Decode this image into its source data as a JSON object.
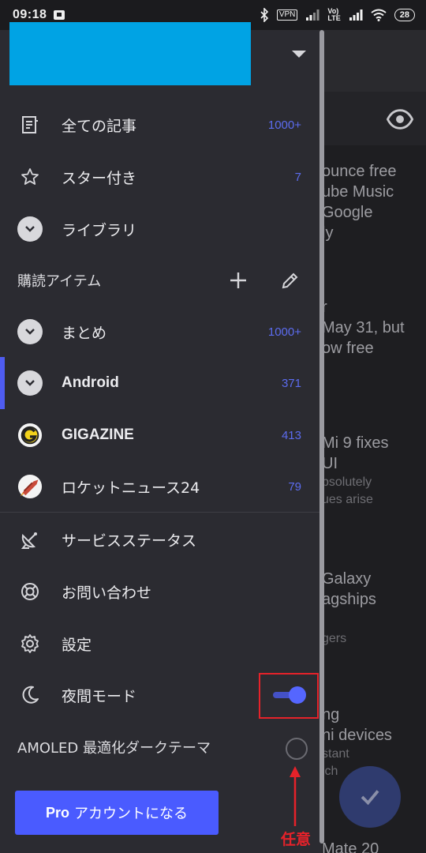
{
  "status_bar": {
    "time": "09:18",
    "vpn": "VPN",
    "network": "Vo)\nLTE",
    "battery": "28"
  },
  "drawer": {
    "items_top": [
      {
        "label": "全ての記事",
        "count": "1000+",
        "icon": "articles-icon"
      },
      {
        "label": "スター付き",
        "count": "7",
        "icon": "star-icon"
      },
      {
        "label": "ライブラリ",
        "count": "",
        "icon": "chevron-down-icon"
      }
    ],
    "subscriptions_label": "購読アイテム",
    "feeds": [
      {
        "label": "まとめ",
        "count": "1000+",
        "icon": "chevron-down-icon"
      },
      {
        "label": "Android",
        "count": "371",
        "icon": "chevron-down-icon"
      },
      {
        "label": "GIGAZINE",
        "count": "413",
        "icon": "gigazine-logo"
      },
      {
        "label": "ロケットニュース24",
        "count": "79",
        "icon": "rocket-icon"
      }
    ],
    "items_bottom": [
      {
        "label": "サービスステータス",
        "icon": "satellite-dish-icon"
      },
      {
        "label": "お問い合わせ",
        "icon": "lifebuoy-icon"
      },
      {
        "label": "設定",
        "icon": "gear-icon"
      },
      {
        "label": "夜間モード",
        "icon": "moon-icon"
      }
    ],
    "night_mode_on": true,
    "amoled_label": "AMOLED 最適化ダークテーマ",
    "pro_button_prefix": "Pro",
    "pro_button_label": "アカウントになる",
    "annotation": "任意"
  },
  "background": {
    "snippets": [
      "ounce free\nube Music\nGoogle\nly",
      "r\nMay 31, but\now free",
      "Mi 9 fixes\nUI",
      "bsolutely\nues arise",
      "Galaxy\nagships",
      "gers",
      "ng\nni devices",
      "stant\nich",
      "Mate 20"
    ]
  },
  "colors": {
    "accent": "#4a5bff",
    "count": "#5c6cf0",
    "annotation": "#e5222a",
    "header_bar": "#00a3e4"
  }
}
